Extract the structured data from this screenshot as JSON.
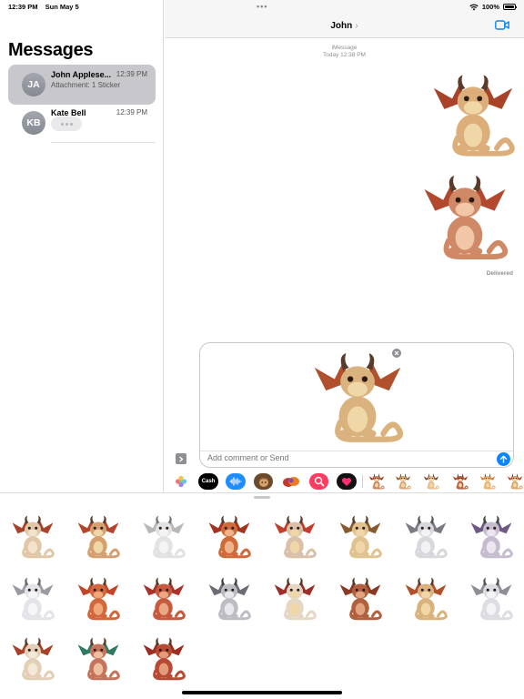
{
  "status_bar": {
    "time": "12:39 PM",
    "date": "Sun May 5",
    "dots": "•••",
    "battery": "100%"
  },
  "sidebar": {
    "title": "Messages",
    "conversations": [
      {
        "initials": "JA",
        "name": "John Applese...",
        "time": "12:39 PM",
        "preview": "Attachment: 1 Sticker"
      },
      {
        "initials": "KB",
        "name": "Kate Bell",
        "time": "12:39 PM",
        "preview": ""
      }
    ]
  },
  "chat": {
    "title": "John",
    "chevron": "›",
    "service": "iMessage",
    "timestamp": "Today 12:38 PM",
    "status": "Delivered"
  },
  "compose": {
    "placeholder": "Add comment or Send"
  },
  "app_strip": [
    {
      "name": "photos-icon",
      "bg": "#ffffff"
    },
    {
      "name": "apple-cash-icon",
      "bg": "#000000",
      "label": "Cash"
    },
    {
      "name": "audio-icon",
      "bg": "#1f8cff"
    },
    {
      "name": "memoji-icon",
      "bg": "#6b4a2d"
    },
    {
      "name": "stickers-app-icon",
      "bg": "#ffffff"
    },
    {
      "name": "search-images-icon",
      "bg": "#ff3b5f"
    },
    {
      "name": "digital-touch-icon",
      "bg": "#111111"
    }
  ],
  "colors": {
    "accent": "#0a84ff",
    "selected_row": "#c7c7cc"
  }
}
